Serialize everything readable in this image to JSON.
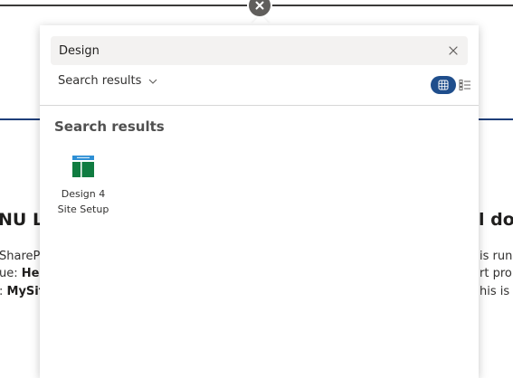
{
  "background": {
    "heading_left": "NU L",
    "heading_right": "l do",
    "lines_left": [
      {
        "prefix": "SharePo",
        "bold": ""
      },
      {
        "prefix": "ue: ",
        "bold": "Hell"
      },
      {
        "prefix": ": ",
        "bold": "MySit"
      }
    ],
    "lines_right": [
      "is runn",
      "rt prop",
      "his is V"
    ]
  },
  "close_button": {
    "icon": "close-icon"
  },
  "search": {
    "value": "Design",
    "placeholder": "",
    "clear_icon": "dismiss-icon"
  },
  "filter": {
    "label": "Search results",
    "icon": "chevron-down-icon"
  },
  "view_toggle": {
    "active": "grid",
    "grid_icon": "grid-view-icon",
    "list_icon": "list-view-icon"
  },
  "results": {
    "title": "Search results",
    "items": [
      {
        "label": "Design 4 Site Setup",
        "icon": "site-design-icon"
      }
    ]
  },
  "colors": {
    "accent": "#1f4e8c",
    "tile_green": "#107c41",
    "tile_blue": "#2d8fd5"
  }
}
